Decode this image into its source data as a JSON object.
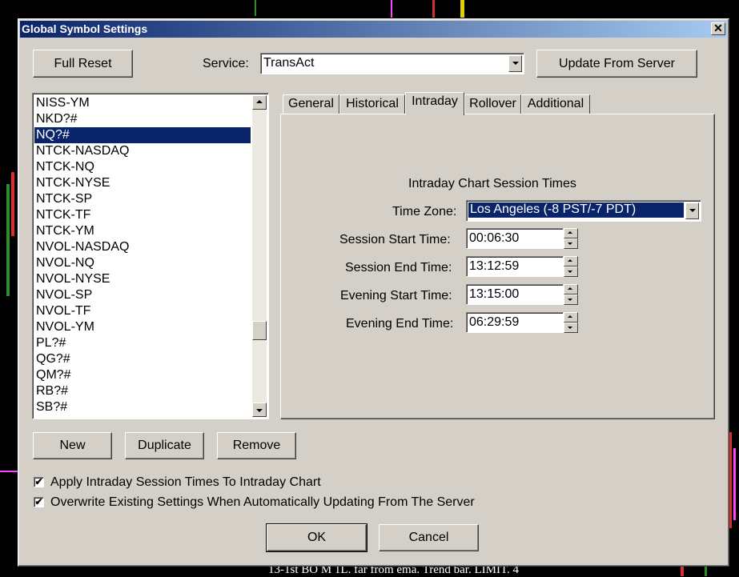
{
  "dialog": {
    "title": "Global Symbol Settings",
    "close_glyph": "✕"
  },
  "top": {
    "full_reset": "Full Reset",
    "service_label": "Service:",
    "service_value": "TransAct",
    "update_from_server": "Update From Server"
  },
  "symbols": {
    "items": [
      "NISS-YM",
      "NKD?#",
      "NQ?#",
      "NTCK-NASDAQ",
      "NTCK-NQ",
      "NTCK-NYSE",
      "NTCK-SP",
      "NTCK-TF",
      "NTCK-YM",
      "NVOL-NASDAQ",
      "NVOL-NQ",
      "NVOL-NYSE",
      "NVOL-SP",
      "NVOL-TF",
      "NVOL-YM",
      "PL?#",
      "QG?#",
      "QM?#",
      "RB?#",
      "SB?#"
    ],
    "selected": "NQ?#"
  },
  "tabs": [
    {
      "label": "General"
    },
    {
      "label": "Historical"
    },
    {
      "label": "Intraday"
    },
    {
      "label": "Rollover"
    },
    {
      "label": "Additional"
    }
  ],
  "active_tab": "Intraday",
  "intraday": {
    "heading": "Intraday Chart Session Times",
    "time_zone_label": "Time Zone:",
    "time_zone_value": "Los Angeles (-8 PST/-7 PDT)",
    "session_start_label": "Session Start Time:",
    "session_start_value": "00:06:30",
    "session_end_label": "Session End Time:",
    "session_end_value": "13:12:59",
    "evening_start_label": "Evening Start Time:",
    "evening_start_value": "13:15:00",
    "evening_end_label": "Evening End Time:",
    "evening_end_value": "06:29:59"
  },
  "list_buttons": {
    "new": "New",
    "duplicate": "Duplicate",
    "remove": "Remove"
  },
  "options": {
    "apply_intraday": "Apply Intraday Session Times To Intraday Chart",
    "apply_intraday_checked": true,
    "overwrite_existing": "Overwrite Existing Settings When Automatically Updating From The Server",
    "overwrite_existing_checked": true,
    "check_glyph": "✔"
  },
  "footer": {
    "ok": "OK",
    "cancel": "Cancel"
  },
  "background": {
    "status_text": "13-1st BO M 1L. far from ema. Trend bar. LIMIT. 4"
  },
  "colors": {
    "selection": "#0a246a",
    "title_start": "#0a246a",
    "title_end": "#a6caf0",
    "face": "#d4d0c8"
  }
}
